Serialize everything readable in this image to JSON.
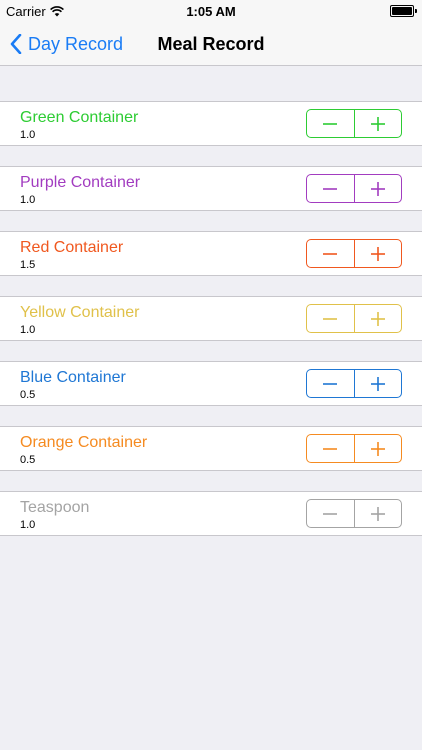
{
  "status_bar": {
    "carrier": "Carrier",
    "time": "1:05 AM"
  },
  "nav": {
    "back_label": "Day Record",
    "title": "Meal Record",
    "accent": "#1a7cf5"
  },
  "items": [
    {
      "name": "Green Container",
      "value": "1.0",
      "color": "#2dcc33"
    },
    {
      "name": "Purple Container",
      "value": "1.0",
      "color": "#a23cc0"
    },
    {
      "name": "Red Container",
      "value": "1.5",
      "color": "#f0581f"
    },
    {
      "name": "Yellow Container",
      "value": "1.0",
      "color": "#e0c14a"
    },
    {
      "name": "Blue Container",
      "value": "0.5",
      "color": "#1f77d4"
    },
    {
      "name": "Orange Container",
      "value": "0.5",
      "color": "#f58b21"
    },
    {
      "name": "Teaspoon",
      "value": "1.0",
      "color": "#a4a4a4"
    }
  ]
}
